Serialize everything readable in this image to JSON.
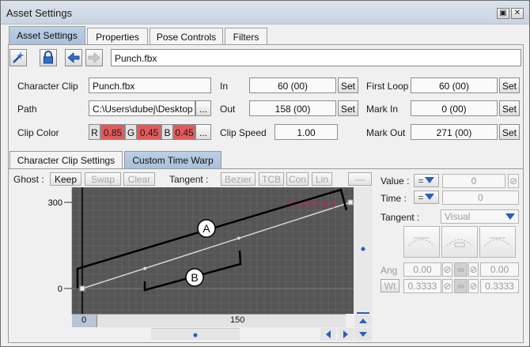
{
  "window": {
    "title": "Asset Settings",
    "restore_glyph": "▣",
    "close_glyph": "✕"
  },
  "tabs": [
    {
      "label": "Asset Settings",
      "active": true
    },
    {
      "label": "Properties",
      "active": false
    },
    {
      "label": "Pose Controls",
      "active": false
    },
    {
      "label": "Filters",
      "active": false
    }
  ],
  "toolbar": {
    "icons": [
      "wand-icon",
      "lock-icon",
      "arrow-left-icon",
      "arrow-right-icon"
    ],
    "clip_name": "Punch.fbx"
  },
  "fields": {
    "character_clip": {
      "label": "Character Clip",
      "value": "Punch.fbx"
    },
    "path": {
      "label": "Path",
      "value": "C:\\Users\\dubej\\Desktop",
      "browse": "..."
    },
    "clip_color": {
      "label": "Clip Color",
      "r_key": "R",
      "r": "0.85",
      "g_key": "G",
      "g": "0.45",
      "b_key": "B",
      "b": "0.45",
      "browse": "..."
    },
    "in": {
      "label": "In",
      "value": "60 (00)",
      "set": "Set"
    },
    "out": {
      "label": "Out",
      "value": "158 (00)",
      "set": "Set"
    },
    "clip_speed": {
      "label": "Clip Speed",
      "value": "1.00"
    },
    "first_loop": {
      "label": "First Loop",
      "value": "60 (00)",
      "set": "Set"
    },
    "mark_in": {
      "label": "Mark In",
      "value": "0 (00)",
      "set": "Set"
    },
    "mark_out": {
      "label": "Mark Out",
      "value": "271 (00)",
      "set": "Set"
    }
  },
  "subtabs": [
    {
      "label": "Character Clip Settings",
      "active": false
    },
    {
      "label": "Custom Time Warp",
      "active": true
    }
  ],
  "graph_toolbar": {
    "ghost_label": "Ghost :",
    "keep": "Keep",
    "swap": "Swap",
    "clear": "Clear",
    "tangent_label": "Tangent :",
    "bezier": "Bezier",
    "tcb": "TCB",
    "con": "Con",
    "lin": "Lin",
    "more": "---"
  },
  "graph": {
    "y_ticks": [
      "300",
      "0"
    ],
    "x_ticks": [
      "0",
      "150"
    ],
    "story_input_label": "(Story Input)",
    "callouts": [
      "A",
      "B"
    ],
    "curve": [
      {
        "frame": 0,
        "value": 0
      },
      {
        "frame": 300,
        "value": 300
      }
    ],
    "colors": {
      "background": "#555555",
      "grid": "#6a6a6a",
      "curve": "#d8d8d8",
      "callout": "#000000",
      "story_label": "#b0305a"
    }
  },
  "right_panel": {
    "value_label": "Value :",
    "value": "0",
    "time_label": "Time :",
    "time": "0",
    "tangent_label": "Tangent :",
    "tangent_value": "Visual",
    "ang_label": "Ang",
    "ang_left": "0.00",
    "ang_right": "0.00",
    "wt_label": "Wt",
    "wt_left": "0.3333",
    "wt_right": "0.3333",
    "equals": "="
  }
}
